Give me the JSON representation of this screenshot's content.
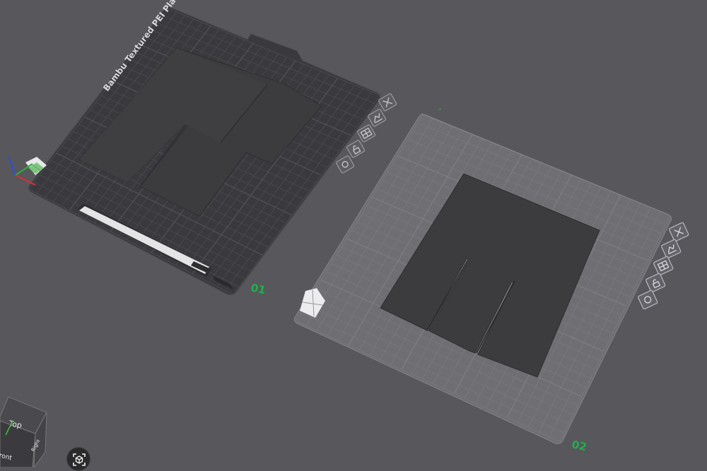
{
  "plates": [
    {
      "number": "01",
      "label": "Bambu Textured PEI Plate",
      "selected": true,
      "color": "#3a3a3e"
    },
    {
      "number": "02",
      "selected": false,
      "color": "#6e6e73"
    }
  ],
  "plate_toolbar": {
    "buttons": [
      {
        "icon": "close-icon"
      },
      {
        "icon": "auto-orient-icon"
      },
      {
        "icon": "arrange-icon"
      },
      {
        "icon": "lock-icon"
      },
      {
        "icon": "settings-icon"
      }
    ]
  },
  "view_cube": {
    "top_label": "Top",
    "front_label": "Front",
    "right_label": "Right"
  },
  "colors": {
    "background": "#57575c",
    "plate_number": "#1fb24a",
    "model": "#3c3c3f"
  }
}
